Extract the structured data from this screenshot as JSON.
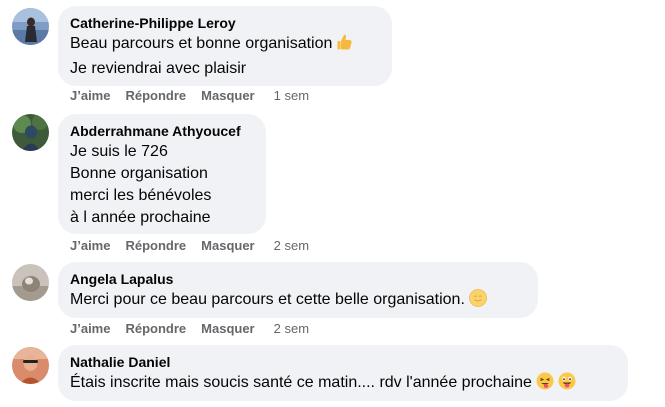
{
  "comments": [
    {
      "author": "Catherine-Philippe Leroy",
      "lines": [
        "Beau parcours et bonne organisation",
        "Je reviendrai avec plaisir"
      ],
      "like_label": "J’aime",
      "reply_label": "Répondre",
      "hide_label": "Masquer",
      "time": "1 sem"
    },
    {
      "author": "Abderrahmane Athyoucef",
      "lines": [
        "Je suis le 726",
        "Bonne organisation",
        "merci les bénévoles",
        "à l année prochaine"
      ],
      "like_label": "J’aime",
      "reply_label": "Répondre",
      "hide_label": "Masquer",
      "time": "2 sem"
    },
    {
      "author": "Angela Lapalus",
      "lines": [
        "Merci pour ce beau parcours et cette belle organisation."
      ],
      "like_label": "J’aime",
      "reply_label": "Répondre",
      "hide_label": "Masquer",
      "time": "2 sem"
    },
    {
      "author": "Nathalie Daniel",
      "lines": [
        "Étais inscrite mais soucis santé ce matin.... rdv l'année prochaine"
      ]
    }
  ],
  "colors": {
    "bubble": "#f0f2f5",
    "meta_text": "#65676b",
    "text": "#050505"
  }
}
